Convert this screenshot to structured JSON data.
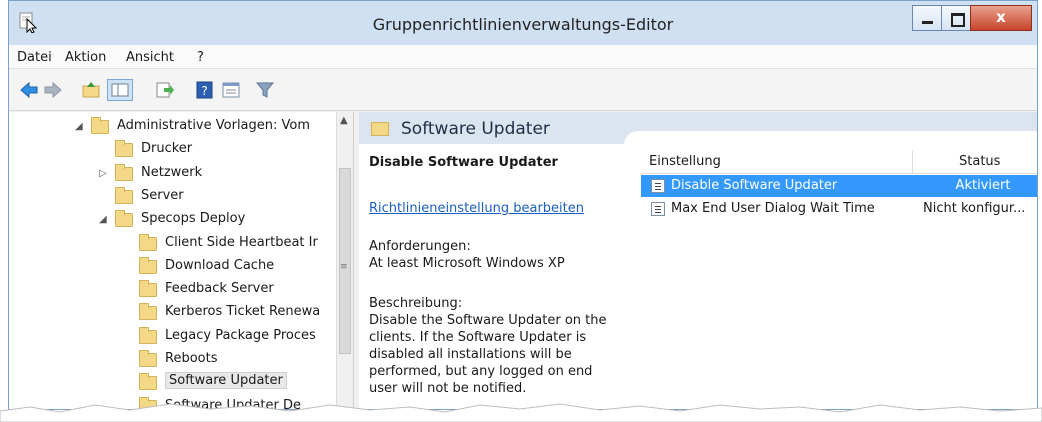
{
  "window": {
    "title": "Gruppenrichtlinienverwaltungs-Editor",
    "close_glyph": "x"
  },
  "menu": [
    "Datei",
    "Aktion",
    "Ansicht",
    "?"
  ],
  "toolbar": {
    "icons": [
      "back-arrow-icon",
      "forward-arrow-icon",
      "up-folder-icon",
      "show-hide-tree-icon",
      "export-list-icon",
      "help-icon",
      "properties-icon",
      "filter-icon"
    ]
  },
  "tree": {
    "items": [
      {
        "label": "Administrative Vorlagen: Vom",
        "twisty": "◢"
      },
      {
        "label": "Drucker",
        "twisty": ""
      },
      {
        "label": "Netzwerk",
        "twisty": "▷"
      },
      {
        "label": "Server",
        "twisty": ""
      },
      {
        "label": "Specops Deploy",
        "twisty": "◢"
      },
      {
        "label": "Client Side Heartbeat Ir",
        "twisty": ""
      },
      {
        "label": "Download Cache",
        "twisty": ""
      },
      {
        "label": "Feedback Server",
        "twisty": ""
      },
      {
        "label": "Kerberos Ticket Renewa",
        "twisty": ""
      },
      {
        "label": "Legacy Package Proces",
        "twisty": ""
      },
      {
        "label": "Reboots",
        "twisty": ""
      },
      {
        "label": "Software Updater",
        "twisty": ""
      },
      {
        "label": "Software Updater De",
        "twisty": ""
      }
    ],
    "scroll_up": "▲",
    "scroll_grip": "≡"
  },
  "detail": {
    "folder_title": "Software Updater",
    "policy_name": "Disable Software Updater",
    "edit_link": "Richtlinieneinstellung bearbeiten",
    "requirements_label": "Anforderungen:",
    "requirements_value": "At least Microsoft Windows XP",
    "description_label": "Beschreibung:",
    "description_text": "Disable the Software Updater on the clients. If the Software Updater is disabled all installations will be performed, but any logged on end user will not be notified."
  },
  "list": {
    "columns": [
      "Einstellung",
      "Status"
    ],
    "rows": [
      {
        "name": "Disable Software Updater",
        "status": "Aktiviert"
      },
      {
        "name": "Max End User Dialog Wait Time",
        "status": "Nicht konfigur..."
      }
    ]
  },
  "colors": {
    "selection": "#3399ff",
    "link": "#1b5fbf",
    "title_bar": "#cfe0f3",
    "close_button": "#c8432a"
  }
}
